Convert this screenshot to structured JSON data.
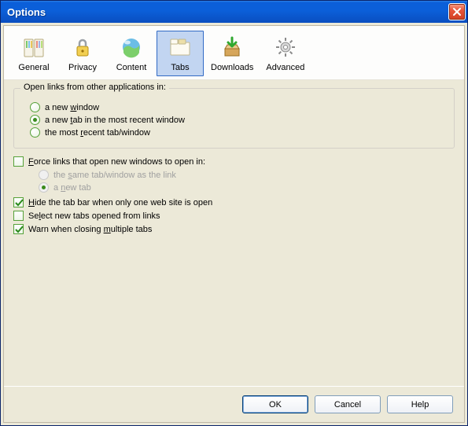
{
  "title": "Options",
  "toolbar": [
    {
      "id": "general",
      "label": "General",
      "selected": false
    },
    {
      "id": "privacy",
      "label": "Privacy",
      "selected": false
    },
    {
      "id": "content",
      "label": "Content",
      "selected": false
    },
    {
      "id": "tabs",
      "label": "Tabs",
      "selected": true
    },
    {
      "id": "downloads",
      "label": "Downloads",
      "selected": false
    },
    {
      "id": "advanced",
      "label": "Advanced",
      "selected": false
    }
  ],
  "group_open_links": {
    "legend": "Open links from other applications in:",
    "options": [
      {
        "id": "new-window",
        "pre": "a new ",
        "u": "w",
        "post": "indow",
        "checked": false
      },
      {
        "id": "new-tab",
        "pre": "a new ",
        "u": "t",
        "post": "ab in the most recent window",
        "checked": true
      },
      {
        "id": "most-recent",
        "pre": "the most ",
        "u": "r",
        "post": "ecent tab/window",
        "checked": false
      }
    ]
  },
  "force_links": {
    "checked": false,
    "pre": "",
    "u": "F",
    "post": "orce links that open new windows to open in:",
    "sub": [
      {
        "id": "same-tab",
        "pre": "the ",
        "u": "s",
        "post": "ame tab/window as the link",
        "disabled": true,
        "checked": false
      },
      {
        "id": "a-new-tab",
        "pre": "a ",
        "u": "n",
        "post": "ew tab",
        "disabled": true,
        "checked": true
      }
    ]
  },
  "checks": [
    {
      "id": "hide-tabbar",
      "pre": "",
      "u": "H",
      "post": "ide the tab bar when only one web site is open",
      "checked": true
    },
    {
      "id": "select-new",
      "pre": "Se",
      "u": "l",
      "post": "ect new tabs opened from links",
      "checked": false
    },
    {
      "id": "warn-close",
      "pre": "Warn when closing ",
      "u": "m",
      "post": "ultiple tabs",
      "checked": true
    }
  ],
  "buttons": {
    "ok": "OK",
    "cancel": "Cancel",
    "help": "Help"
  }
}
